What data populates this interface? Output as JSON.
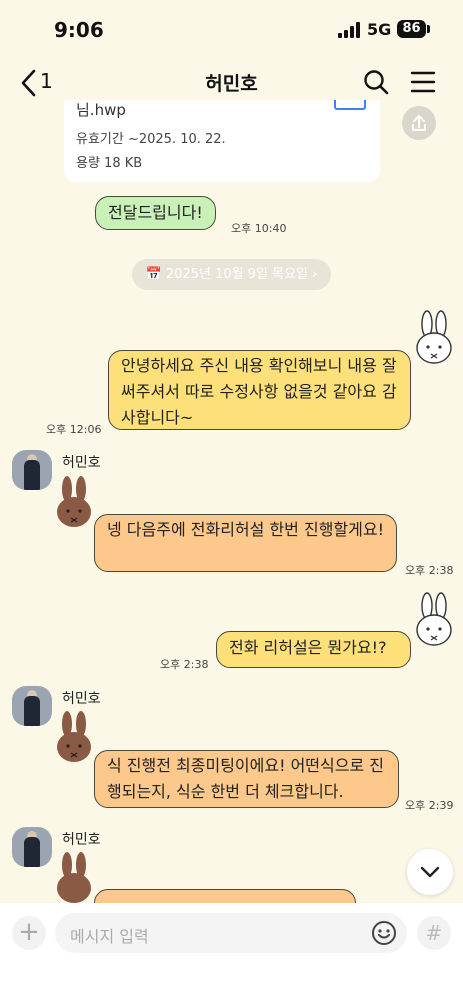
{
  "status_bar": {
    "time": "9:06",
    "network": "5G",
    "battery": "86"
  },
  "header": {
    "back_count": "1",
    "title": "허민호"
  },
  "file_card": {
    "name": "님.hwp",
    "expiry": "유효기간  ~2025. 10. 22.",
    "size": "용량  18 KB"
  },
  "date_divider": "📅 2025년 10월 9일 목요일 ›",
  "messages": [
    {
      "text": "전달드립니다!",
      "time": "오후 10:40"
    },
    {
      "text": "안녕하세요 주신 내용 확인해보니 내용 잘써주셔서 따로 수정사항 없을것 같아요 감사합니다~",
      "time": "오후 12:06"
    },
    {
      "sender": "허민호",
      "text": "넹 다음주에 전화리허설 한번 진행할게요!",
      "time": "오후 2:38"
    },
    {
      "text": "전화 리허설은 뭔가요!?",
      "time": "오후 2:38"
    },
    {
      "sender": "허민호",
      "text": "식 진행전 최종미팅이에요! 어떤식으로 진행되는지, 식순  한번 더 체크합니다.",
      "time": "오후 2:39"
    },
    {
      "sender": "허민호",
      "text": ""
    }
  ],
  "input": {
    "placeholder": "메시지 입력"
  },
  "colors": {
    "background": "#fbf8e8",
    "green_bubble": "#c9f0b6",
    "yellow_bubble": "#fde07a",
    "orange_bubble": "#fcc88c"
  },
  "icons": [
    "chevron-left-icon",
    "search-icon",
    "hamburger-menu-icon",
    "share-icon",
    "bunny-sticker",
    "chevron-down-icon",
    "plus-icon",
    "emoji-icon",
    "hash-icon"
  ]
}
